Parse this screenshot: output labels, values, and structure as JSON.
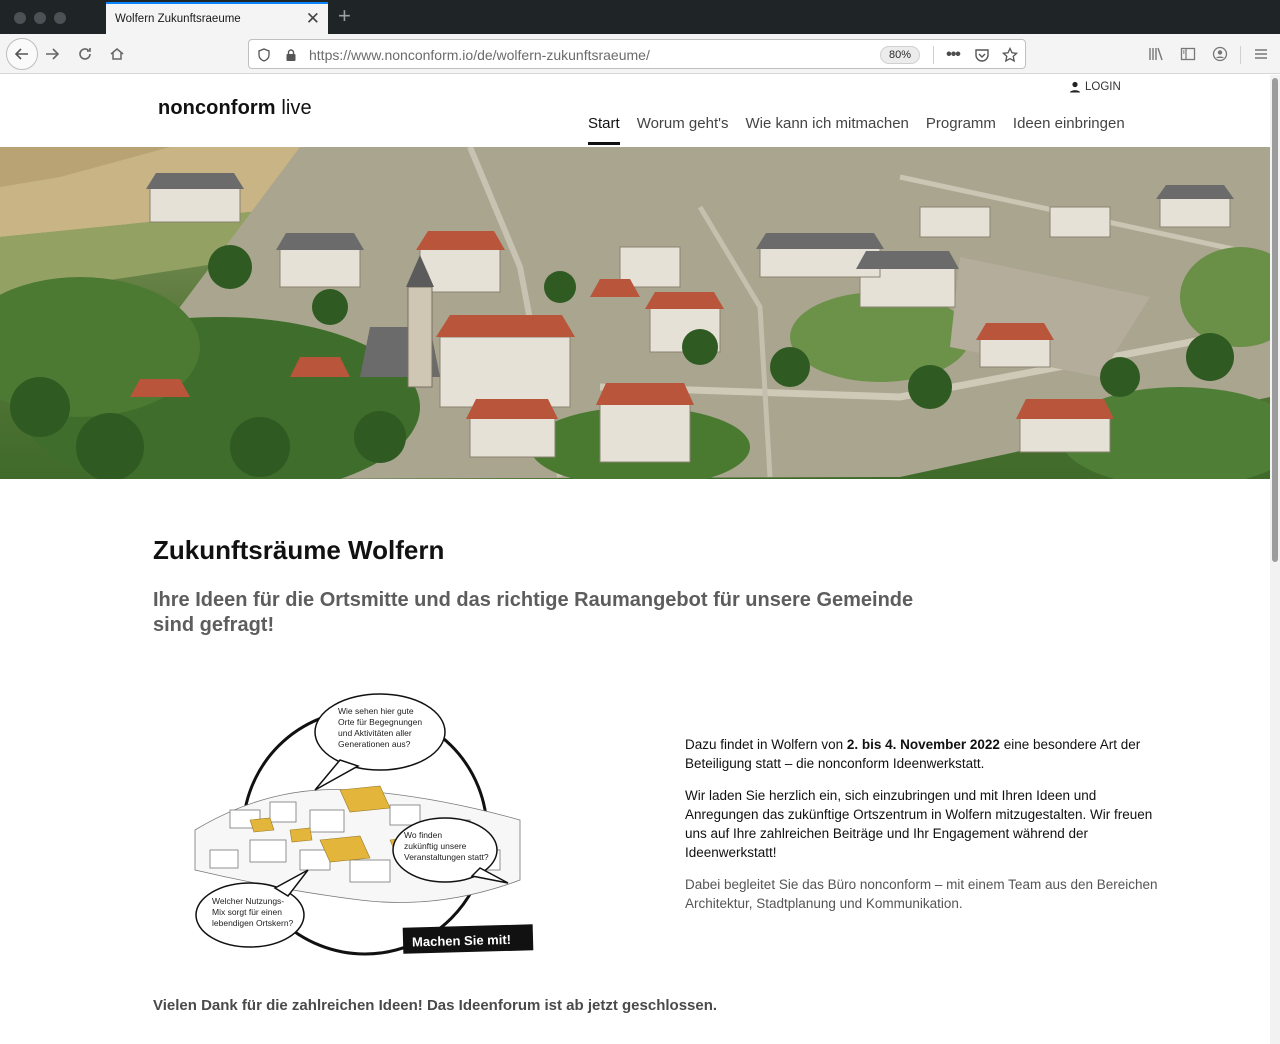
{
  "browser": {
    "tab_title": "Wolfern Zukunftsraeume",
    "url_host": "https://www.nonconform.io",
    "url_path": "/de/wolfern-zukunftsraeume/",
    "zoom": "80%"
  },
  "site": {
    "logo_bold": "nonconform",
    "logo_light": " live",
    "login": "LOGIN",
    "menu": [
      {
        "label": "Start"
      },
      {
        "label": "Worum geht's"
      },
      {
        "label": "Wie kann ich mitmachen"
      },
      {
        "label": "Programm"
      },
      {
        "label": "Ideen einbringen"
      }
    ],
    "active_menu_index": 0
  },
  "content": {
    "title": "Zukunftsräume Wolfern",
    "subtitle": "Ihre Ideen für die Ortsmitte und das richtige Raumangebot für unsere Gemeinde sind gefragt!",
    "illustration": {
      "bubble1": [
        "Wie sehen hier gute",
        "Orte für Begegnungen",
        "und Aktivitäten aller",
        "Generationen aus?"
      ],
      "bubble2": [
        "Wo finden",
        "zukünftig unsere",
        "Veranstaltungen statt?"
      ],
      "bubble3": [
        "Welcher Nutzungs-",
        "Mix sorgt für einen",
        "lebendigen Ortskern?"
      ],
      "cta": "Machen Sie mit!"
    },
    "para1_pre": "Dazu findet in Wolfern von ",
    "para1_bold": "2. bis 4. November 2022",
    "para1_post": " eine besondere Art der Beteiligung statt – die nonconform Ideenwerkstatt.",
    "para2": "Wir laden Sie herzlich ein, sich einzubringen und mit Ihren Ideen und Anregungen das zukünftige Ortszentrum in Wolfern mitzugestalten. Wir freuen uns auf Ihre zahlreichen Beiträge und Ihr Engagement während der Ideenwerkstatt!",
    "para3": "Dabei begleitet Sie das Büro nonconform – mit einem Team aus den Bereichen Architektur, Stadtplanung und Kommunikation.",
    "closing": "Vielen Dank für die zahlreichen Ideen! Das Ideenforum ist ab jetzt geschlossen."
  },
  "colors": {
    "tab_accent": "#0a84ff",
    "chrome_dark": "#1f2427",
    "illustration_yellow": "#e3b53a"
  }
}
